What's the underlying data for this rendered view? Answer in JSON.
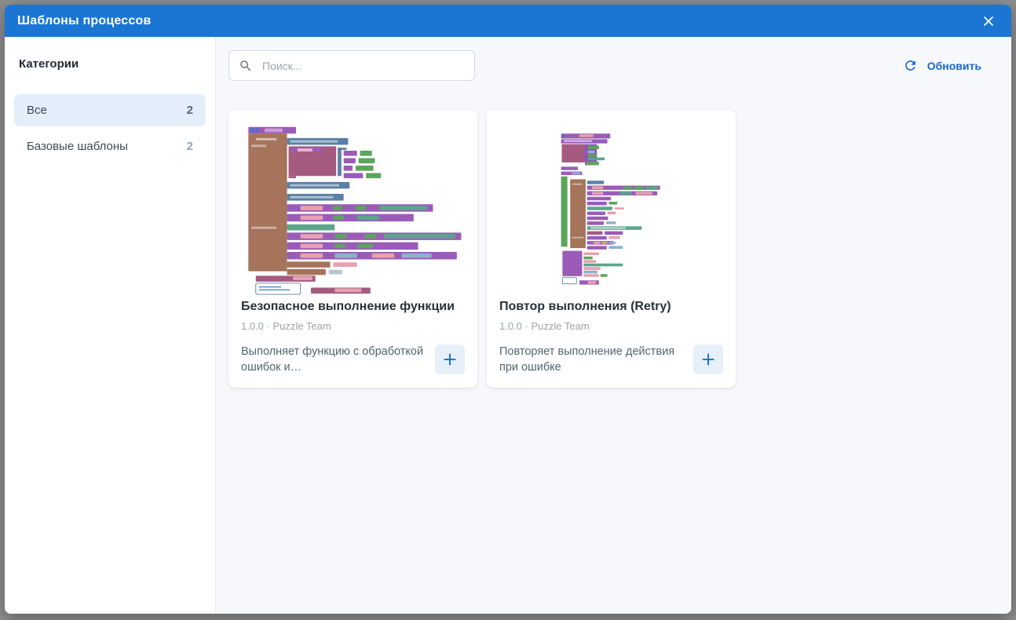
{
  "modal": {
    "title": "Шаблоны процессов"
  },
  "sidebar": {
    "heading": "Категории",
    "items": [
      {
        "label": "Все",
        "count": "2",
        "selected": true
      },
      {
        "label": "Базовые шаблоны",
        "count": "2",
        "selected": false
      }
    ]
  },
  "toolbar": {
    "search_placeholder": "Поиск...",
    "refresh_label": "Обновить"
  },
  "cards": [
    {
      "title": "Безопасное выполнение функции",
      "version": "1.0.0",
      "author": "Puzzle Team",
      "meta": "1.0.0 · Puzzle Team",
      "description": "Выполняет функцию с обработкой ошибок и…"
    },
    {
      "title": "Повтор выполнения (Retry)",
      "version": "1.0.0",
      "author": "Puzzle Team",
      "meta": "1.0.0 · Puzzle Team",
      "description": "Повторяет выполнение действия при ошибке"
    }
  ],
  "icons": {
    "close": "close-icon",
    "search": "search-icon",
    "refresh": "refresh-icon",
    "plus": "plus-icon"
  },
  "colors": {
    "header_blue": "#1b76d3",
    "refresh_blue": "#1767cf",
    "selected_category_bg": "#e4eefb",
    "content_bg": "#f7f8fc",
    "add_button_bg": "#e7eff9",
    "backdrop_gray": "#8e8e8e"
  }
}
